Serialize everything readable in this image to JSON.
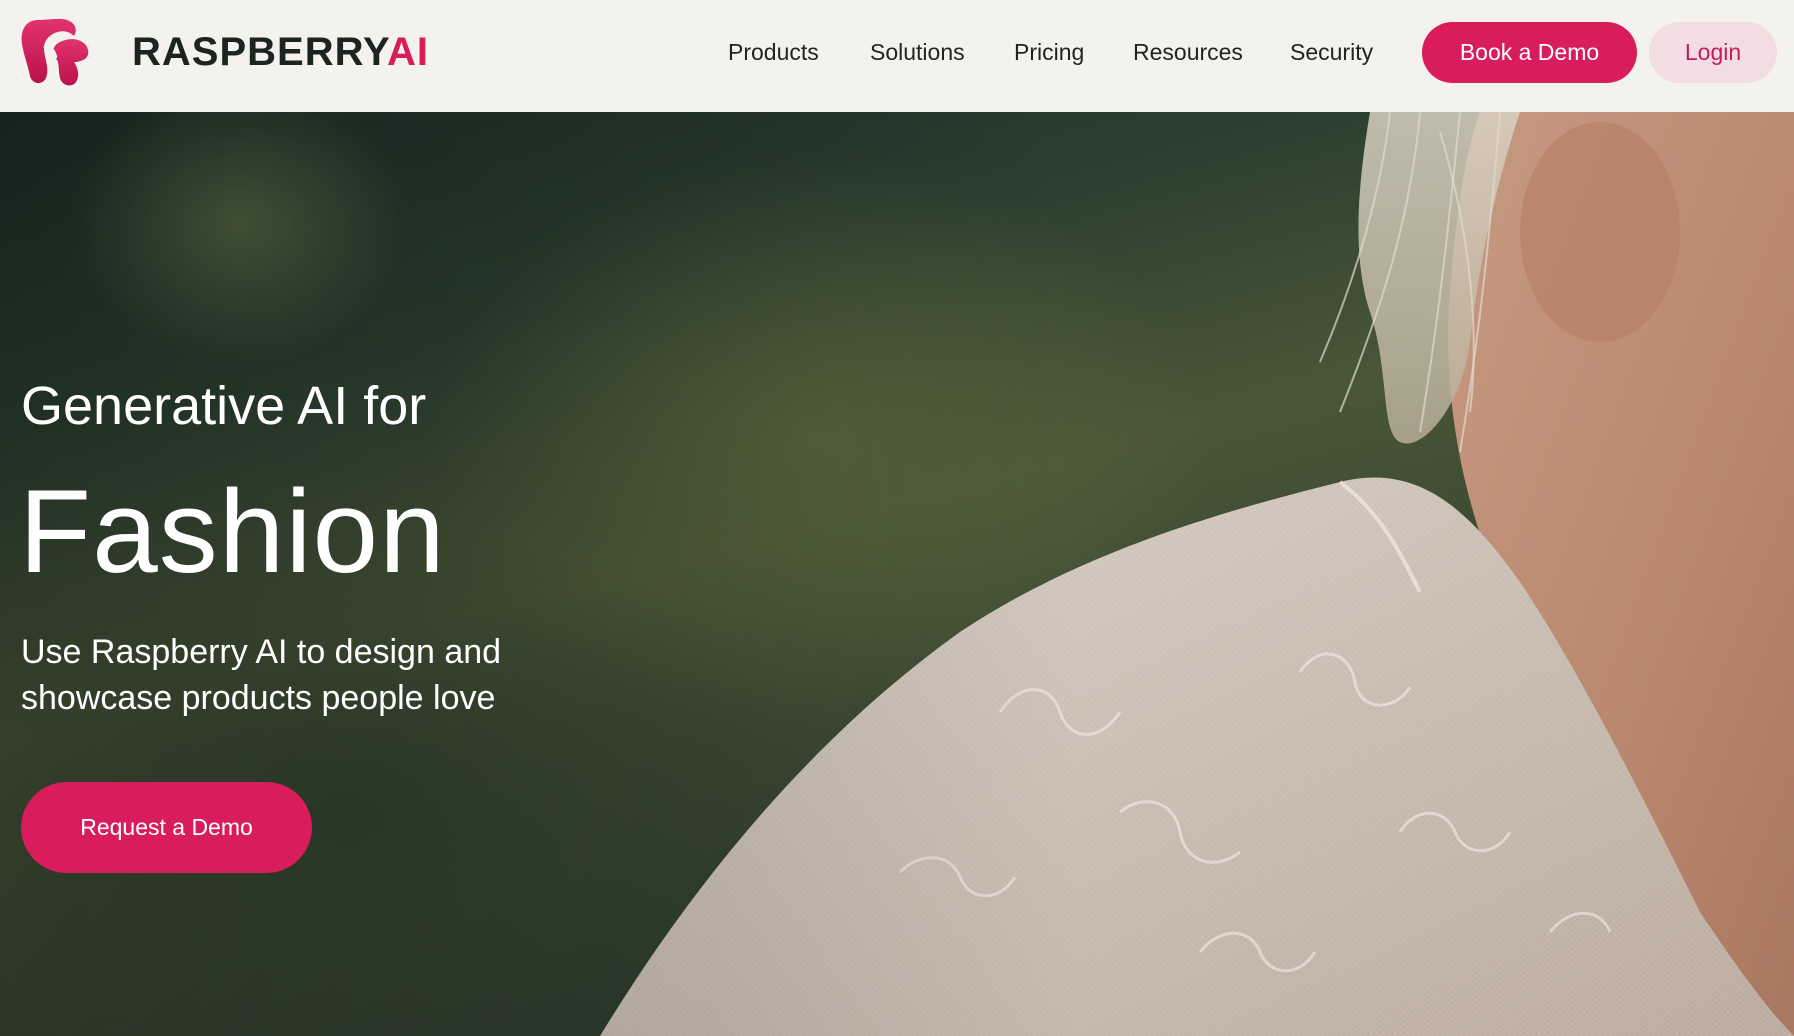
{
  "brand": {
    "name_main": "RASPBERRY",
    "name_accent": "AI",
    "logo_icon": "raspberry-r-logo-icon",
    "accent_color": "#d81c5c",
    "text_color": "#1c2320"
  },
  "nav": {
    "items": [
      "Products",
      "Solutions",
      "Pricing",
      "Resources",
      "Security"
    ],
    "book_demo_label": "Book a Demo",
    "login_label": "Login"
  },
  "hero": {
    "kicker": "Generative AI for",
    "title": "Fashion",
    "subtitle": "Use Raspberry AI to design and showcase products people love",
    "cta_label": "Request a Demo",
    "background_image": "woman in white lace blouse against blurred green foliage"
  },
  "colors": {
    "header_bg": "#f3f2ef",
    "primary_button": "#d81c5c",
    "secondary_button_bg": "#f2dde2",
    "secondary_button_text": "#c81c57"
  }
}
